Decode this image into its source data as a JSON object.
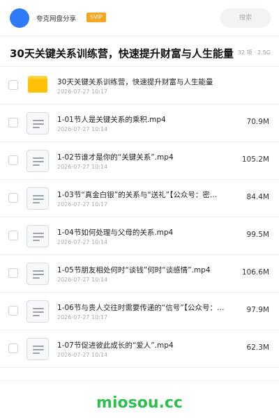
{
  "topbar": {
    "app_name": "夸克网盘分享",
    "badge": "SVIP",
    "search_placeholder": "搜索",
    "avatar_color": "#2f7bf5",
    "badge_color": "#f5a623"
  },
  "header": {
    "title": "30天关键关系训练营，快速提升财富与人生能量",
    "meta": "32 项 · 2.5G"
  },
  "files": [
    {
      "icon": "folder-icon",
      "name": "30天关键关系训练营，快速提升财富与人生能量",
      "date": "2026-07-27 10:17",
      "size": ""
    },
    {
      "icon": "document-icon",
      "name": "1-01节人是关键关系的乘积.mp4",
      "date": "2026-07-27 10:14",
      "size": "70.9M"
    },
    {
      "icon": "document-icon",
      "name": "1-02节谁才是你的“关键关系”.mp4",
      "date": "2026-07-27 10:14",
      "size": "105.2M"
    },
    {
      "icon": "document-icon",
      "name": "1-03节“真金白银”的关系与“送礼”【公众号：密…",
      "date": "2026-07-27 10:17",
      "size": "84.4M"
    },
    {
      "icon": "document-icon",
      "name": "1-04节如何处理与父母的关系.mp4",
      "date": "2026-07-27 10:14",
      "size": "99.5M"
    },
    {
      "icon": "document-icon",
      "name": "1-05节朋友相处何时“谈钱”何时“谈感情”.mp4",
      "date": "2026-07-27 10:14",
      "size": "106.6M"
    },
    {
      "icon": "document-icon",
      "name": "1-06节与贵人交往时需要传递的“信号”【公众号：…",
      "date": "2026-07-27 10:17",
      "size": "97.9M"
    },
    {
      "icon": "document-icon",
      "name": "1-07节促进彼此成长的“爱人”.mp4",
      "date": "2026-07-27 10:14",
      "size": "62.3M"
    }
  ],
  "watermark": "miosou.cc",
  "colors": {
    "folder": "#ffc107",
    "watermark": "#2fbf4f"
  }
}
